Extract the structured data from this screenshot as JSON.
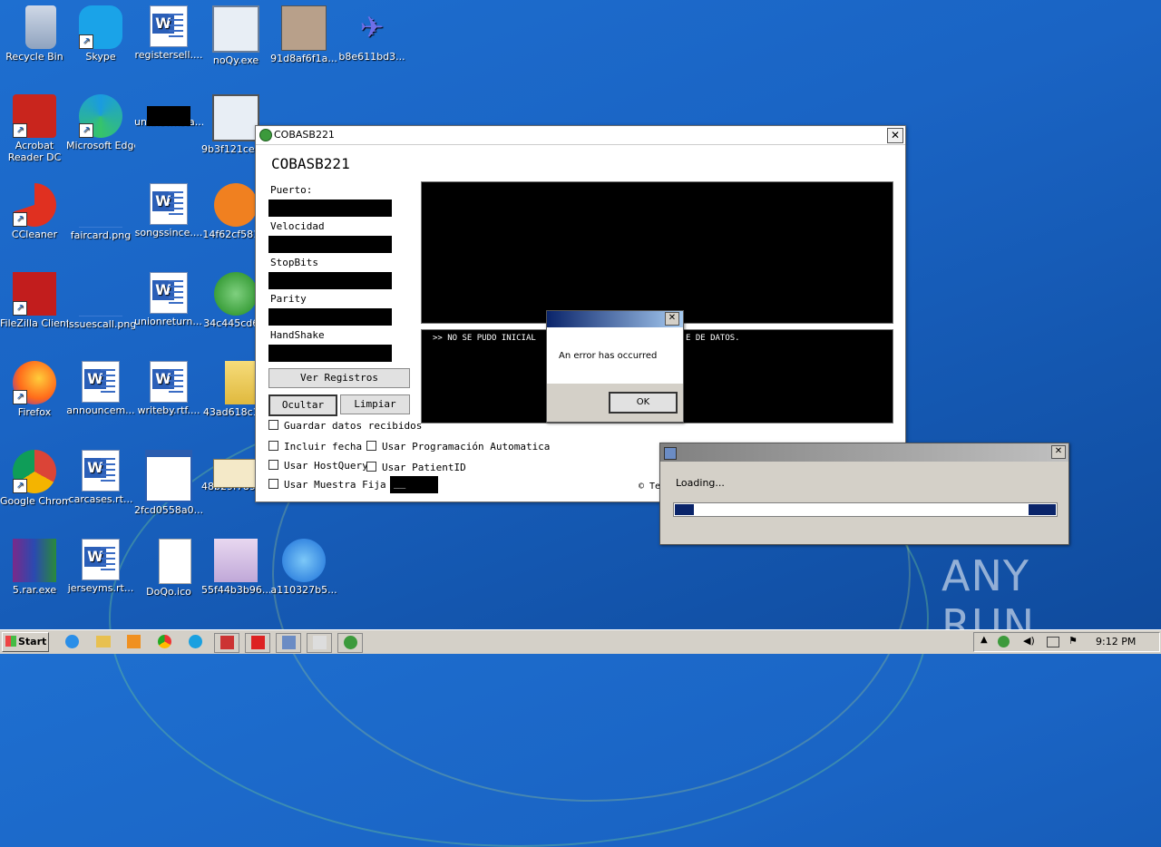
{
  "desktop_icons": [
    {
      "label": "Recycle Bin",
      "icon": "recycle-bin-icon"
    },
    {
      "label": "Skype",
      "icon": "skype-icon"
    },
    {
      "label": "registersell....",
      "icon": "word-doc-icon"
    },
    {
      "label": "noQy.exe",
      "icon": "exe-icon"
    },
    {
      "label": "91d8af6f1a...",
      "icon": "app-icon"
    },
    {
      "label": "b8e611bd3...",
      "icon": "plane-icon"
    },
    {
      "label": "Acrobat Reader DC",
      "icon": "acrobat-icon"
    },
    {
      "label": "Microsoft Edge",
      "icon": "edge-icon"
    },
    {
      "label": "unknownsta...",
      "icon": "blank-icon"
    },
    {
      "label": "9b3f121ce9...",
      "icon": "info-icon"
    },
    {
      "label": "CCleaner",
      "icon": "ccleaner-icon"
    },
    {
      "label": "faircard.png",
      "icon": "png-icon"
    },
    {
      "label": "songssince....",
      "icon": "word-doc-icon"
    },
    {
      "label": "14f62cf581...",
      "icon": "firstaid-icon"
    },
    {
      "label": "FileZilla Client",
      "icon": "filezilla-icon"
    },
    {
      "label": "issuescall.png",
      "icon": "png-icon"
    },
    {
      "label": "unionreturn....",
      "icon": "word-doc-icon"
    },
    {
      "label": "34c445cd6...",
      "icon": "radar-icon"
    },
    {
      "label": "Firefox",
      "icon": "firefox-icon"
    },
    {
      "label": "announcem...",
      "icon": "word-doc-icon"
    },
    {
      "label": "writeby.rtf....",
      "icon": "word-doc-icon"
    },
    {
      "label": "43ad618c1...",
      "icon": "folder-icon"
    },
    {
      "label": "Google Chrome",
      "icon": "chrome-icon"
    },
    {
      "label": "carcases.rt...",
      "icon": "word-doc-icon"
    },
    {
      "label": "2fcd0558a0...",
      "icon": "window-icon"
    },
    {
      "label": "48b29f7896...",
      "icon": "mail-icon"
    },
    {
      "label": "5.rar.exe",
      "icon": "winrar-icon"
    },
    {
      "label": "jerseyms.rt...",
      "icon": "word-doc-icon"
    },
    {
      "label": "DoQo.ico",
      "icon": "file-icon"
    },
    {
      "label": "55f44b3b96...",
      "icon": "anime-icon"
    },
    {
      "label": "a110327b5...",
      "icon": "ie-icon"
    }
  ],
  "main_window": {
    "title": "COBASB221",
    "heading": "COBASB221",
    "fields": [
      "Puerto:",
      "Velocidad",
      "StopBits",
      "Parity",
      "HandShake"
    ],
    "buttons": {
      "ver": "Ver Registros",
      "ocultar": "Ocultar",
      "limpiar": "Limpiar"
    },
    "checkboxes": {
      "guardar": "Guardar datos recibidos",
      "fecha": "Incluir fecha",
      "programacion": "Usar Programación Automatica",
      "hostquery": "Usar HostQuery",
      "patientid": "Usar PatientID",
      "muestra": "Usar Muestra Fija"
    },
    "muestra_value": "__",
    "log_left": ">> NO SE PUDO INICIAL",
    "log_right": "E DE DATOS.",
    "footer": "© Te"
  },
  "error_dialog": {
    "message": "An error has occurred",
    "ok": "OK"
  },
  "loading_dialog": {
    "message": "Loading...",
    "progress": 0.05
  },
  "watermark": "ANY RUN",
  "taskbar": {
    "start": "Start",
    "clock": "9:12 PM"
  }
}
